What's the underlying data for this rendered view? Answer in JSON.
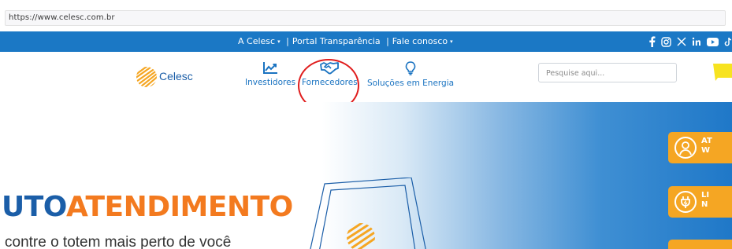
{
  "browser": {
    "url": "https://www.celesc.com.br"
  },
  "topbar": {
    "links": [
      {
        "label": "A Celesc",
        "has_caret": true
      },
      {
        "label": "Portal Transparência"
      },
      {
        "label": "Fale conosco",
        "has_caret": true
      }
    ],
    "separator": "|",
    "caret_glyph": "▾",
    "social_icons": [
      "facebook-icon",
      "instagram-icon",
      "x-twitter-icon",
      "linkedin-icon",
      "youtube-icon",
      "tiktok-icon"
    ],
    "background_color": "#1b78c5"
  },
  "header": {
    "logo_text": "Celesc",
    "nav": [
      {
        "label": "Investidores",
        "icon": "chart-up-icon"
      },
      {
        "label": "Fornecedores",
        "icon": "handshake-icon",
        "highlighted": true
      },
      {
        "label": "Soluções em Energia",
        "icon": "lightbulb-icon"
      }
    ],
    "search_placeholder": "Pesquise aqui...",
    "accent_color": "#1a73c1",
    "highlight_color": "#e01d1d"
  },
  "hero": {
    "title_part_dark": "UTO",
    "title_part_orange": "ATENDIMENTO",
    "subtitle": "contre o totem mais perto de você",
    "side_buttons": [
      {
        "label_line1": "AT",
        "label_line2": "W",
        "icon": "person-icon"
      },
      {
        "label_line1": "LI",
        "label_line2": "N",
        "icon": "power-plug-icon"
      },
      {
        "label_line1": "",
        "label_line2": "",
        "icon": ""
      }
    ],
    "title_dark_color": "#1b5ea8",
    "title_orange_color": "#f37a1f",
    "button_color": "#f5a623"
  }
}
